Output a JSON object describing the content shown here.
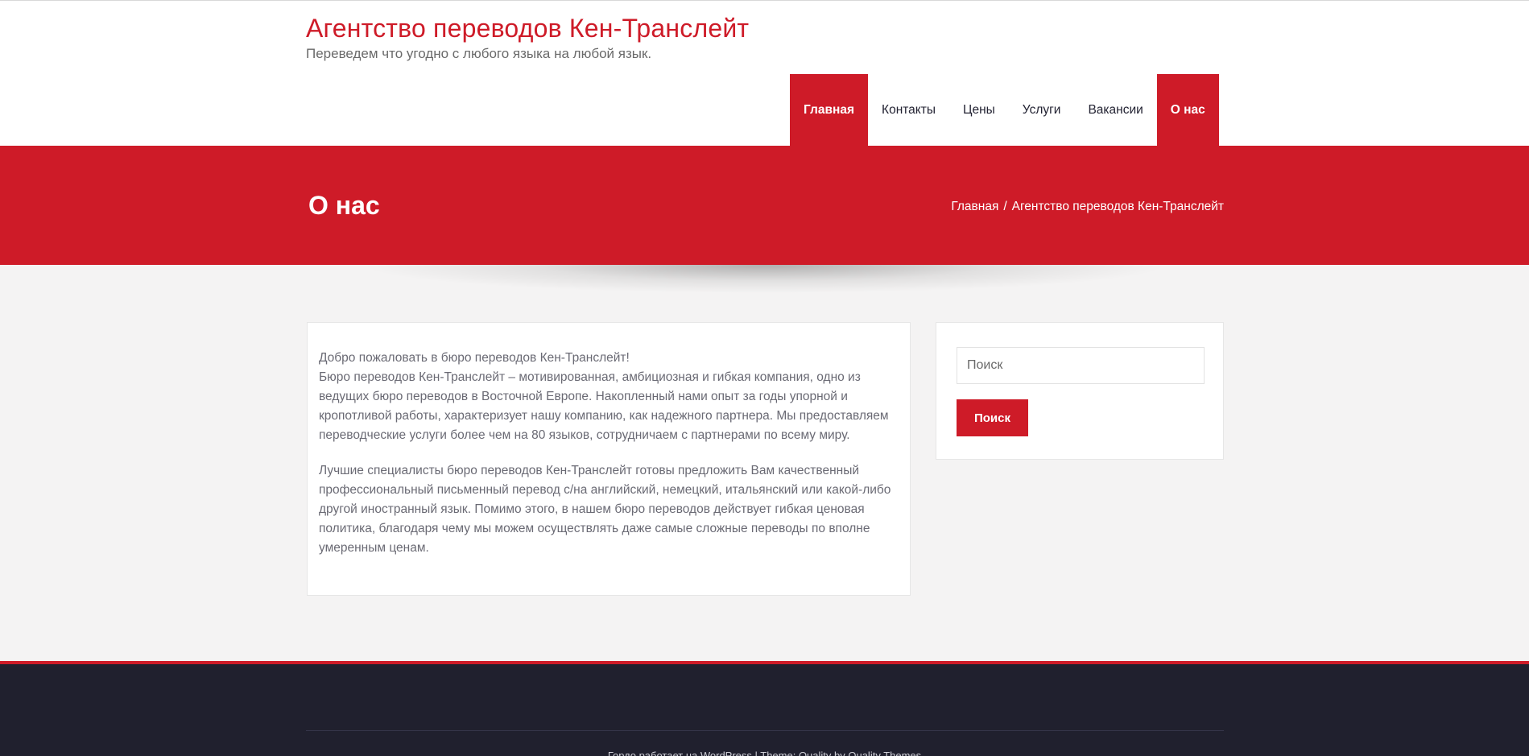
{
  "site": {
    "title": "Агентство переводов Кен-Транслейт",
    "description": "Переведем что угодно с любого языка на любой язык."
  },
  "nav": {
    "items": [
      {
        "label": "Главная",
        "active": true
      },
      {
        "label": "Контакты",
        "active": false
      },
      {
        "label": "Цены",
        "active": false
      },
      {
        "label": "Услуги",
        "active": false
      },
      {
        "label": "Вакансии",
        "active": false
      },
      {
        "label": "О нас",
        "active": true
      }
    ]
  },
  "banner": {
    "page_title": "О нас",
    "breadcrumb": {
      "home": "Главная",
      "separator": "/",
      "current": "Агентство переводов Кен-Транслейт"
    }
  },
  "content": {
    "paragraphs": [
      "Добро пожаловать в бюро переводов Кен-Транслейт!\nБюро переводов Кен-Транслейт – мотивированная, амбициозная и гибкая компания, одно из ведущих бюро переводов в Восточной Европе. Накопленный нами опыт за годы упорной и кропотливой работы, характеризует нашу компанию, как надежного партнера. Мы предоставляем переводческие услуги более чем на 80 языков, сотрудничаем с партнерами по всему миру.",
      "Лучшие специалисты бюро переводов Кен-Транслейт готовы предложить Вам качественный профессиональный письменный перевод с/на английский, немецкий, итальянский или какой-либо другой иностранный язык. Помимо этого, в нашем бюро переводов действует гибкая ценовая политика, благодаря чему мы можем осуществлять даже самые сложные переводы по вполне умеренным ценам."
    ]
  },
  "sidebar": {
    "search_placeholder": "Поиск",
    "search_button": "Поиск"
  },
  "footer": {
    "credit": "Гордо работает на WordPress | Theme: Quality by Quality Themes"
  },
  "colors": {
    "brand": "#ce1b28",
    "footer_bg": "#20202e",
    "page_bg": "#f4f3f3"
  }
}
